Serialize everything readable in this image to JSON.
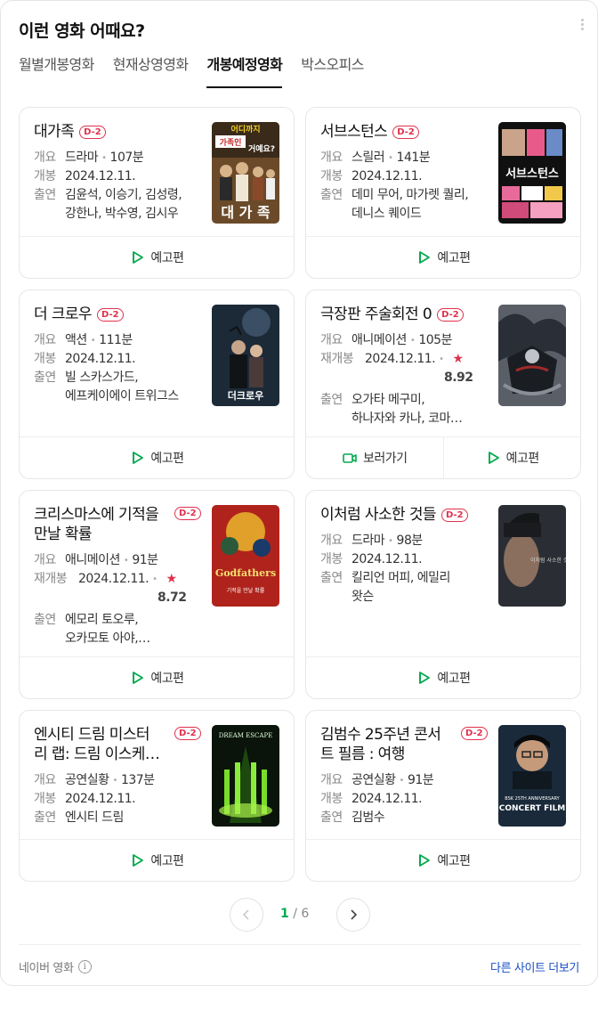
{
  "widget": {
    "title": "이런 영화 어때요?",
    "tabs": [
      "월별개봉영화",
      "현재상영영화",
      "개봉예정영화",
      "박스오피스"
    ],
    "active_tab": "개봉예정영화"
  },
  "labels": {
    "summary": "개요",
    "release": "개봉",
    "rerelease": "재개봉",
    "cast": "출연",
    "trailer": "예고편",
    "watch": "보러가기"
  },
  "movies": [
    {
      "title": "대가족",
      "badge": "D-2",
      "genre": "드라마",
      "runtime": "107분",
      "date": "2024.12.11.",
      "cast1": "김윤석, 이승기, 김성령,",
      "cast2": "강한나, 박수영, 김시우"
    },
    {
      "title": "서브스턴스",
      "badge": "D-2",
      "genre": "스릴러",
      "runtime": "141분",
      "date": "2024.12.11.",
      "cast1": "데미 무어, 마가렛 퀄리,",
      "cast2": "데니스 퀘이드"
    },
    {
      "title": "더 크로우",
      "badge": "D-2",
      "genre": "액션",
      "runtime": "111분",
      "date": "2024.12.11.",
      "cast1": "빌 스카스가드,",
      "cast2": "에프케이에이 트위그스"
    },
    {
      "title": "극장판 주술회전 0",
      "badge": "D-2",
      "genre": "애니메이션",
      "runtime": "105분",
      "date": "2024.12.11.",
      "rating": "8.92",
      "cast1": "오가타 메구미,",
      "cast2": "하나자와 카나, 코마…"
    },
    {
      "title1": "크리스마스에 기적을",
      "title2": "만날 확률",
      "badge": "D-2",
      "genre": "애니메이션",
      "runtime": "91분",
      "date": "2024.12.11.",
      "rating": "8.72",
      "cast1": "에모리 토오루,",
      "cast2": "오카모토 아야,…"
    },
    {
      "title": "이처럼 사소한 것들",
      "badge": "D-2",
      "genre": "드라마",
      "runtime": "98분",
      "date": "2024.12.11.",
      "cast1": "킬리언 머피, 에밀리",
      "cast2": "왓슨"
    },
    {
      "title1": "엔시티 드림 미스터",
      "title2": "리 랩: 드림 이스케…",
      "badge": "D-2",
      "genre": "공연실황",
      "runtime": "137분",
      "date": "2024.12.11.",
      "cast1": "엔시티 드림"
    },
    {
      "title1": "김범수 25주년 콘서",
      "title2": "트 필름 : 여행",
      "badge": "D-2",
      "genre": "공연실황",
      "runtime": "91분",
      "date": "2024.12.11.",
      "cast1": "김범수"
    }
  ],
  "posters": {
    "p1": {
      "top": "어디까지",
      "mid1": "가족인",
      "mid2": "거예요?",
      "bottom": "대 가 족"
    },
    "p2": {
      "main": "서브스턴스"
    },
    "p3": {
      "main": "더크로우"
    },
    "p5": {
      "main": "Godfathers",
      "sub": "기적을 만날 확률"
    },
    "p6": {
      "main": "이처럼 사소한 것들"
    },
    "p7": {
      "main": "DREAM ESCAPE"
    },
    "p8": {
      "line1": "BSK 25TH ANNIVERSARY",
      "line2": "CONCERT FILM"
    }
  },
  "pager": {
    "current": "1",
    "sep": "/",
    "total": "6"
  },
  "footer": {
    "source": "네이버 영화",
    "info_icon": "i",
    "other_sites": "다른 사이트 더보기"
  },
  "colors": {
    "accent": "#03a94d",
    "badge": "#e0314c",
    "link": "#1a4ec5"
  }
}
